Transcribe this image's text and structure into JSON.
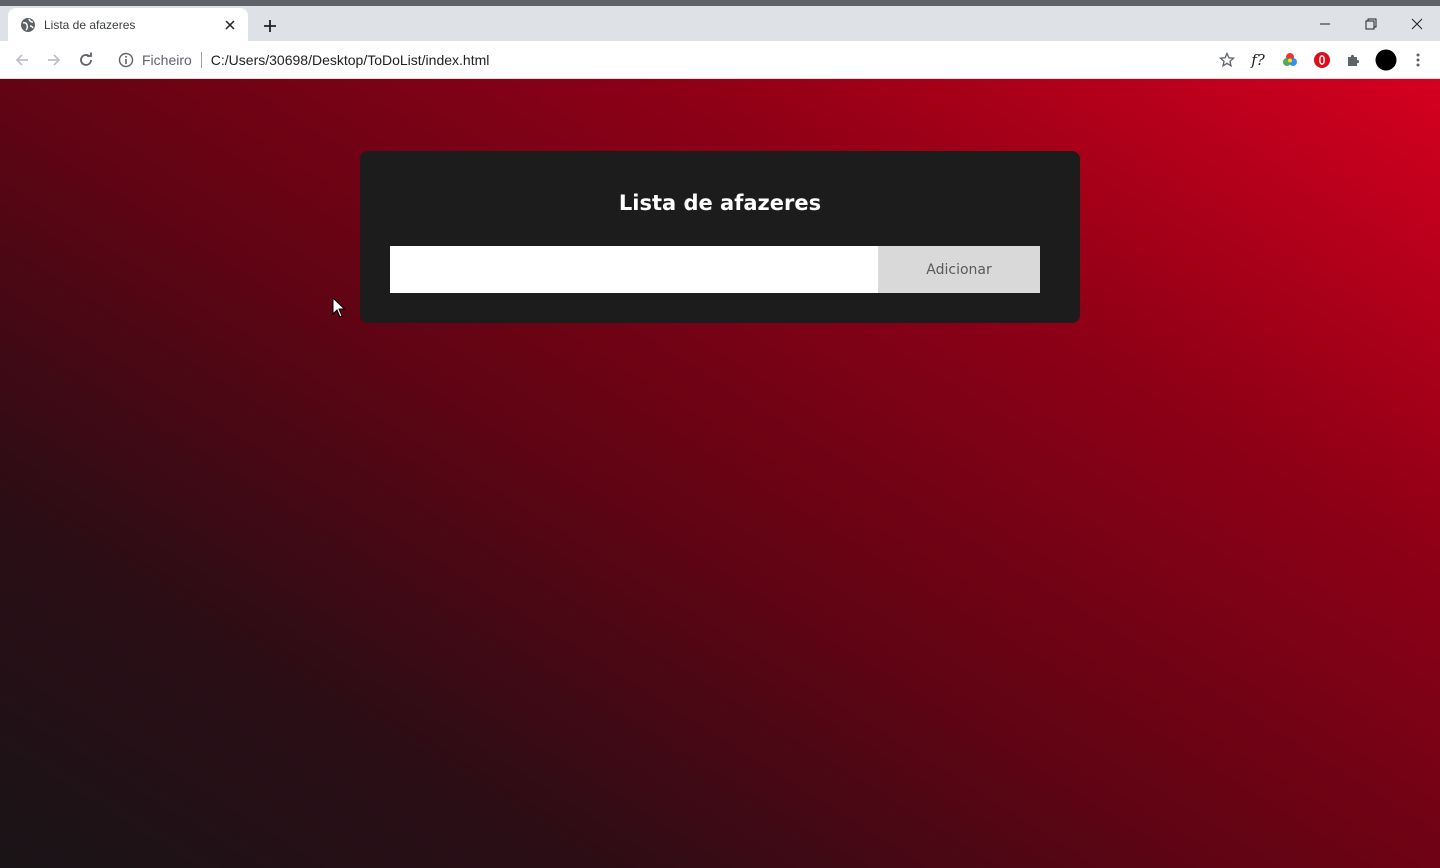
{
  "browser": {
    "tab": {
      "title": "Lista de afazeres"
    },
    "address": {
      "scheme": "Ficheiro",
      "url": "C:/Users/30698/Desktop/ToDoList/index.html"
    },
    "extensions": {
      "fonts_label": "f?"
    }
  },
  "page": {
    "title": "Lista de afazeres",
    "input": {
      "value": "",
      "placeholder": ""
    },
    "add_button_label": "Adicionar"
  },
  "colors": {
    "gradient_dark": "#191417",
    "gradient_red": "#d4001f",
    "card_bg": "#1c1c1c",
    "button_bg": "#d9d9d9"
  }
}
